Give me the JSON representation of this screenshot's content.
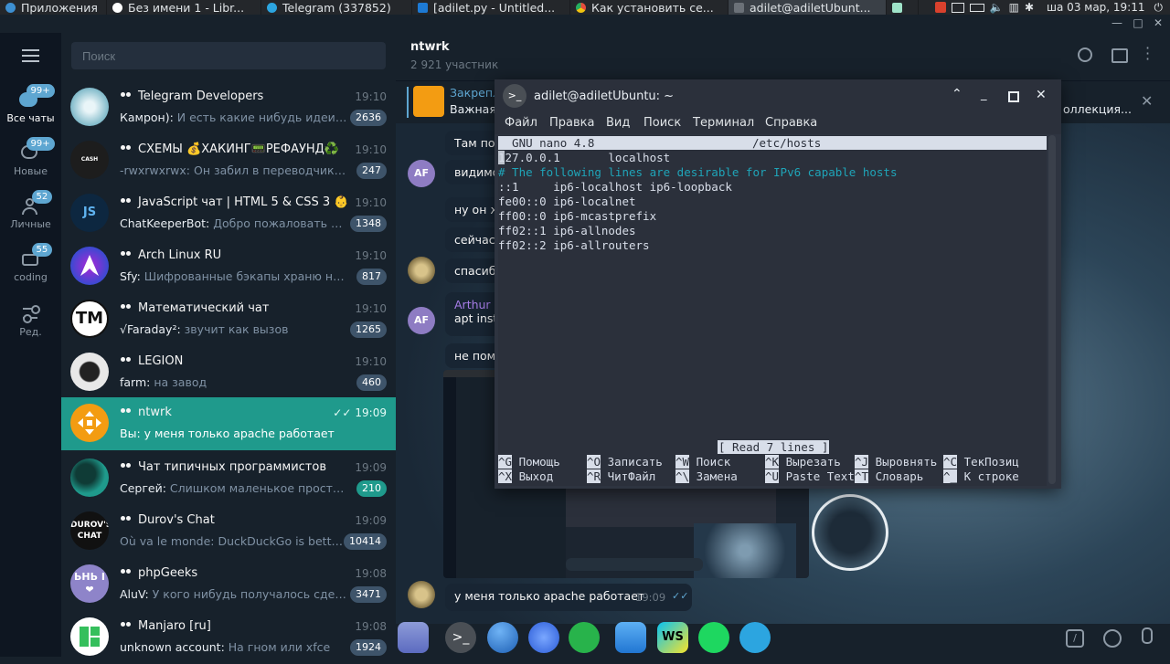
{
  "system_panel": {
    "items": [
      {
        "label": "Приложения",
        "icon": "distro-menu-icon"
      },
      {
        "label": "Без имени 1 - Libr...",
        "icon": "libreoffice-icon"
      },
      {
        "label": "Telegram (337852)",
        "icon": "telegram-icon"
      },
      {
        "label": "[adilet.py - Untitled...",
        "icon": "vscode-icon"
      },
      {
        "label": "Как установить се...",
        "icon": "chrome-icon"
      },
      {
        "label": "adilet@adiletUbunt...",
        "icon": "terminal-icon"
      }
    ],
    "clock": "ша 03 мар, 19:11"
  },
  "folders": [
    {
      "label": "Все чаты",
      "badge": "99+",
      "icon": "chat-bubbles-icon"
    },
    {
      "label": "Новые",
      "badge": "99+",
      "icon": "chat-bubble-icon"
    },
    {
      "label": "Личные",
      "badge": "52",
      "icon": "person-icon"
    },
    {
      "label": "coding",
      "badge": "55",
      "icon": "folder-icon"
    },
    {
      "label": "Ред.",
      "badge": "",
      "icon": "sliders-icon"
    }
  ],
  "search": {
    "placeholder": "Поиск"
  },
  "chats": [
    {
      "name": "Telegram Developers",
      "time": "19:10",
      "who": "Камрон):",
      "text": " И есть какие нибудь идеи, как ...",
      "unread": "2636",
      "avatar": "",
      "avatar_color": "#7fb9c9"
    },
    {
      "name": "СХЕМЫ 💰ХАКИНГ📟РЕФАУНД♻️",
      "time": "19:10",
      "who": "",
      "text": "-rwxrwxrwx: Он забил в переводчик ему т...",
      "unread": "247",
      "avatar": "CASH PLANET",
      "avatar_color": "#1d1d1d"
    },
    {
      "name": "JavaScript чат | HTML 5 & CSS 3 👶",
      "time": "19:10",
      "who": "ChatKeeperBot:",
      "text": " Добро пожаловать в ком...",
      "unread": "1348",
      "avatar": "JS",
      "avatar_color": "#0d2740"
    },
    {
      "name": "Arch Linux RU",
      "time": "19:10",
      "who": "Sfy:",
      "text": " Шифрованные бэкапы храню на вне...",
      "unread": "817",
      "avatar": "",
      "avatar_color": "#3b4ad1"
    },
    {
      "name": "Математический чат",
      "time": "19:10",
      "who": "√Faraday²:",
      "text": " звучит как вызов",
      "unread": "1265",
      "avatar": "TM",
      "avatar_color": "#ffffff"
    },
    {
      "name": "LEGION",
      "time": "19:10",
      "who": "farm:",
      "text": " на завод",
      "unread": "460",
      "avatar": "",
      "avatar_color": "#e8e8e8"
    },
    {
      "name": "ntwrk",
      "time": "19:09",
      "who": "Вы:",
      "text": " у меня только apache работает",
      "unread": "",
      "avatar": "",
      "avatar_color": "#f39c12"
    },
    {
      "name": "Чат типичных программистов",
      "time": "19:09",
      "who": "Сергей:",
      "text": " Слишком маленькое пространств...",
      "unread": "210",
      "avatar": "",
      "avatar_color": "#1f9a8c"
    },
    {
      "name": "Durov's Chat",
      "time": "19:09",
      "who": "",
      "text": "Où va le monde: DuckDuckGo is better th...",
      "unread": "10414",
      "avatar": "DUROV'S CHAT",
      "avatar_color": "#111111"
    },
    {
      "name": "phpGeeks",
      "time": "19:08",
      "who": "AluV:",
      "text": " У кого нибудь получалось сделать ...",
      "unread": "3471",
      "avatar": "ЬНЬ I❤",
      "avatar_color": "#8e84c9"
    },
    {
      "name": "Manjaro [ru]",
      "time": "19:08",
      "who": "unknown account:",
      "text": " На гном или xfce",
      "unread": "1924",
      "avatar": "",
      "avatar_color": "#35bf5c"
    }
  ],
  "chat_header": {
    "title": "ntwrk",
    "subtitle": "2 921 участник"
  },
  "pinned": {
    "label": "Закрепл",
    "text": "Важная",
    "right_text": "оллекция..."
  },
  "messages": [
    {
      "text": "Там по",
      "author": ""
    },
    {
      "text": "видимо",
      "author": "",
      "avatar": "AF"
    },
    {
      "text": "ну он ж",
      "author": ""
    },
    {
      "text": "сейчас",
      "author": ""
    },
    {
      "text": "спасиб",
      "author": ""
    },
    {
      "text": "apt inst",
      "author": "Arthur",
      "avatar": "AF"
    },
    {
      "text": "не пом",
      "author": ""
    }
  ],
  "last_message": {
    "text": "у меня только apache работает",
    "time": "19:09"
  },
  "terminal": {
    "title": "adilet@adiletUbuntu: ~",
    "menu": [
      "Файл",
      "Правка",
      "Вид",
      "Поиск",
      "Терминал",
      "Справка"
    ],
    "nano_header_left": "  GNU nano 4.8",
    "nano_header_right": "/etc/hosts",
    "lines": [
      "127.0.0.1       localhost",
      "# The following lines are desirable for IPv6 capable hosts",
      "::1     ip6-localhost ip6-loopback",
      "fe00::0 ip6-localnet",
      "ff00::0 ip6-mcastprefix",
      "ff02::1 ip6-allnodes",
      "ff02::2 ip6-allrouters"
    ],
    "status": "[ Read 7 lines ]",
    "shortcuts_row1": [
      {
        "key": "^G",
        "label": "Помощь"
      },
      {
        "key": "^O",
        "label": "Записать"
      },
      {
        "key": "^W",
        "label": "Поиск"
      },
      {
        "key": "^K",
        "label": "Вырезать"
      },
      {
        "key": "^J",
        "label": "Выровнять"
      },
      {
        "key": "^C",
        "label": "ТекПозиц"
      }
    ],
    "shortcuts_row2": [
      {
        "key": "^X",
        "label": "Выход"
      },
      {
        "key": "^R",
        "label": "ЧитФайл"
      },
      {
        "key": "^\\",
        "label": "Замена"
      },
      {
        "key": "^U",
        "label": "Paste Text"
      },
      {
        "key": "^T",
        "label": "Словарь"
      },
      {
        "key": "^_",
        "label": "К строке"
      }
    ]
  },
  "colors": {
    "sidebar_bg": "#0e1621",
    "list_bg": "#17212b",
    "selected_chat": "#1f9a8c",
    "badge": "#5ea6d1",
    "unread_muted": "#3e546a",
    "terminal_bg": "#2b303b",
    "nano_comment": "#1fa4b8"
  }
}
